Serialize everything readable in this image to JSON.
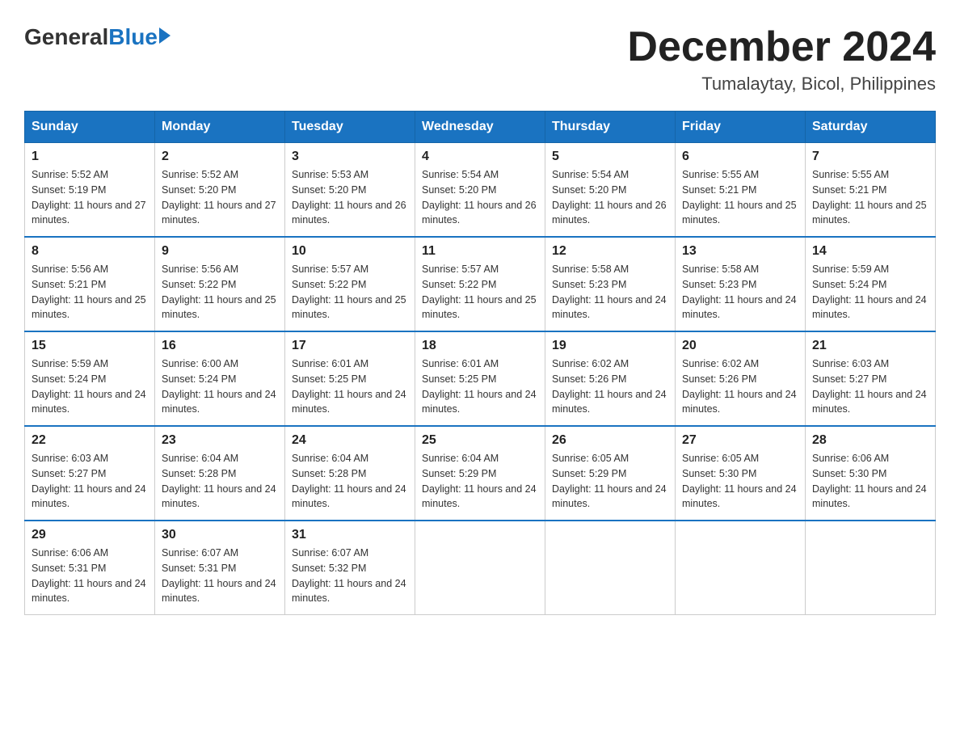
{
  "logo": {
    "general": "General",
    "blue": "Blue"
  },
  "title": "December 2024",
  "subtitle": "Tumalaytay, Bicol, Philippines",
  "days_of_week": [
    "Sunday",
    "Monday",
    "Tuesday",
    "Wednesday",
    "Thursday",
    "Friday",
    "Saturday"
  ],
  "weeks": [
    [
      {
        "day": "1",
        "sunrise": "5:52 AM",
        "sunset": "5:19 PM",
        "daylight": "11 hours and 27 minutes."
      },
      {
        "day": "2",
        "sunrise": "5:52 AM",
        "sunset": "5:20 PM",
        "daylight": "11 hours and 27 minutes."
      },
      {
        "day": "3",
        "sunrise": "5:53 AM",
        "sunset": "5:20 PM",
        "daylight": "11 hours and 26 minutes."
      },
      {
        "day": "4",
        "sunrise": "5:54 AM",
        "sunset": "5:20 PM",
        "daylight": "11 hours and 26 minutes."
      },
      {
        "day": "5",
        "sunrise": "5:54 AM",
        "sunset": "5:20 PM",
        "daylight": "11 hours and 26 minutes."
      },
      {
        "day": "6",
        "sunrise": "5:55 AM",
        "sunset": "5:21 PM",
        "daylight": "11 hours and 25 minutes."
      },
      {
        "day": "7",
        "sunrise": "5:55 AM",
        "sunset": "5:21 PM",
        "daylight": "11 hours and 25 minutes."
      }
    ],
    [
      {
        "day": "8",
        "sunrise": "5:56 AM",
        "sunset": "5:21 PM",
        "daylight": "11 hours and 25 minutes."
      },
      {
        "day": "9",
        "sunrise": "5:56 AM",
        "sunset": "5:22 PM",
        "daylight": "11 hours and 25 minutes."
      },
      {
        "day": "10",
        "sunrise": "5:57 AM",
        "sunset": "5:22 PM",
        "daylight": "11 hours and 25 minutes."
      },
      {
        "day": "11",
        "sunrise": "5:57 AM",
        "sunset": "5:22 PM",
        "daylight": "11 hours and 25 minutes."
      },
      {
        "day": "12",
        "sunrise": "5:58 AM",
        "sunset": "5:23 PM",
        "daylight": "11 hours and 24 minutes."
      },
      {
        "day": "13",
        "sunrise": "5:58 AM",
        "sunset": "5:23 PM",
        "daylight": "11 hours and 24 minutes."
      },
      {
        "day": "14",
        "sunrise": "5:59 AM",
        "sunset": "5:24 PM",
        "daylight": "11 hours and 24 minutes."
      }
    ],
    [
      {
        "day": "15",
        "sunrise": "5:59 AM",
        "sunset": "5:24 PM",
        "daylight": "11 hours and 24 minutes."
      },
      {
        "day": "16",
        "sunrise": "6:00 AM",
        "sunset": "5:24 PM",
        "daylight": "11 hours and 24 minutes."
      },
      {
        "day": "17",
        "sunrise": "6:01 AM",
        "sunset": "5:25 PM",
        "daylight": "11 hours and 24 minutes."
      },
      {
        "day": "18",
        "sunrise": "6:01 AM",
        "sunset": "5:25 PM",
        "daylight": "11 hours and 24 minutes."
      },
      {
        "day": "19",
        "sunrise": "6:02 AM",
        "sunset": "5:26 PM",
        "daylight": "11 hours and 24 minutes."
      },
      {
        "day": "20",
        "sunrise": "6:02 AM",
        "sunset": "5:26 PM",
        "daylight": "11 hours and 24 minutes."
      },
      {
        "day": "21",
        "sunrise": "6:03 AM",
        "sunset": "5:27 PM",
        "daylight": "11 hours and 24 minutes."
      }
    ],
    [
      {
        "day": "22",
        "sunrise": "6:03 AM",
        "sunset": "5:27 PM",
        "daylight": "11 hours and 24 minutes."
      },
      {
        "day": "23",
        "sunrise": "6:04 AM",
        "sunset": "5:28 PM",
        "daylight": "11 hours and 24 minutes."
      },
      {
        "day": "24",
        "sunrise": "6:04 AM",
        "sunset": "5:28 PM",
        "daylight": "11 hours and 24 minutes."
      },
      {
        "day": "25",
        "sunrise": "6:04 AM",
        "sunset": "5:29 PM",
        "daylight": "11 hours and 24 minutes."
      },
      {
        "day": "26",
        "sunrise": "6:05 AM",
        "sunset": "5:29 PM",
        "daylight": "11 hours and 24 minutes."
      },
      {
        "day": "27",
        "sunrise": "6:05 AM",
        "sunset": "5:30 PM",
        "daylight": "11 hours and 24 minutes."
      },
      {
        "day": "28",
        "sunrise": "6:06 AM",
        "sunset": "5:30 PM",
        "daylight": "11 hours and 24 minutes."
      }
    ],
    [
      {
        "day": "29",
        "sunrise": "6:06 AM",
        "sunset": "5:31 PM",
        "daylight": "11 hours and 24 minutes."
      },
      {
        "day": "30",
        "sunrise": "6:07 AM",
        "sunset": "5:31 PM",
        "daylight": "11 hours and 24 minutes."
      },
      {
        "day": "31",
        "sunrise": "6:07 AM",
        "sunset": "5:32 PM",
        "daylight": "11 hours and 24 minutes."
      },
      null,
      null,
      null,
      null
    ]
  ],
  "labels": {
    "sunrise": "Sunrise:",
    "sunset": "Sunset:",
    "daylight": "Daylight:"
  }
}
